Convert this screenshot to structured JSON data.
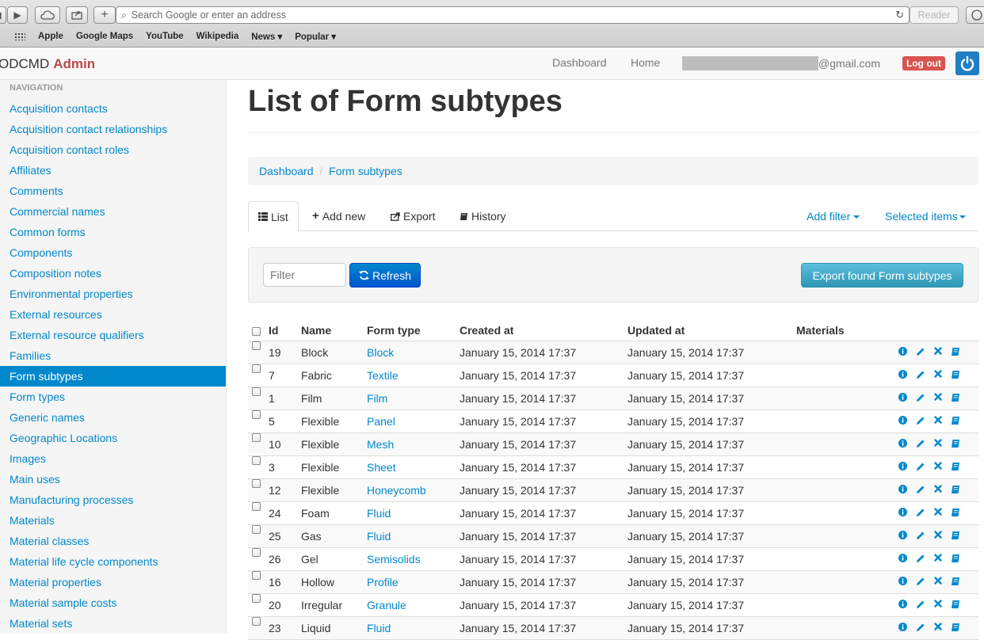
{
  "browser": {
    "address_placeholder": "Search Google or enter an address",
    "reader_label": "Reader",
    "bookmarks": [
      "Apple",
      "Google Maps",
      "YouTube",
      "Wikipedia",
      "News ▾",
      "Popular ▾"
    ]
  },
  "navbar": {
    "brand_prefix": "ODCMD",
    "brand_suffix": "Admin",
    "links": [
      "Dashboard",
      "Home"
    ],
    "email_suffix": "@gmail.com",
    "logout_label": "Log out"
  },
  "sidebar": {
    "header": "NAVIGATION",
    "items": [
      "Acquisition contacts",
      "Acquisition contact relationships",
      "Acquisition contact roles",
      "Affiliates",
      "Comments",
      "Commercial names",
      "Common forms",
      "Components",
      "Composition notes",
      "Environmental properties",
      "External resources",
      "External resource qualifiers",
      "Families",
      "Form subtypes",
      "Form types",
      "Generic names",
      "Geographic Locations",
      "Images",
      "Main uses",
      "Manufacturing processes",
      "Materials",
      "Material classes",
      "Material life cycle components",
      "Material properties",
      "Material sample costs",
      "Material sets"
    ],
    "active_index": 13
  },
  "main": {
    "title": "List of Form subtypes",
    "breadcrumb": [
      "Dashboard",
      "Form subtypes"
    ],
    "breadcrumb_sep": "/",
    "tabs": [
      "List",
      "Add new",
      "Export",
      "History"
    ],
    "tab_right": [
      "Add filter",
      "Selected items"
    ],
    "filter_placeholder": "Filter",
    "refresh_label": "Refresh",
    "export_label": "Export found Form subtypes"
  },
  "table": {
    "columns": [
      "Id",
      "Name",
      "Form type",
      "Created at",
      "Updated at",
      "Materials"
    ],
    "rows": [
      {
        "id": "19",
        "name": "Block",
        "form_type": "Block",
        "created": "January 15, 2014 17:37",
        "updated": "January 15, 2014 17:37"
      },
      {
        "id": "7",
        "name": "Fabric",
        "form_type": "Textile",
        "created": "January 15, 2014 17:37",
        "updated": "January 15, 2014 17:37"
      },
      {
        "id": "1",
        "name": "Film",
        "form_type": "Film",
        "created": "January 15, 2014 17:37",
        "updated": "January 15, 2014 17:37"
      },
      {
        "id": "5",
        "name": "Flexible",
        "form_type": "Panel",
        "created": "January 15, 2014 17:37",
        "updated": "January 15, 2014 17:37"
      },
      {
        "id": "10",
        "name": "Flexible",
        "form_type": "Mesh",
        "created": "January 15, 2014 17:37",
        "updated": "January 15, 2014 17:37"
      },
      {
        "id": "3",
        "name": "Flexible",
        "form_type": "Sheet",
        "created": "January 15, 2014 17:37",
        "updated": "January 15, 2014 17:37"
      },
      {
        "id": "12",
        "name": "Flexible",
        "form_type": "Honeycomb",
        "created": "January 15, 2014 17:37",
        "updated": "January 15, 2014 17:37"
      },
      {
        "id": "24",
        "name": "Foam",
        "form_type": "Fluid",
        "created": "January 15, 2014 17:37",
        "updated": "January 15, 2014 17:37"
      },
      {
        "id": "25",
        "name": "Gas",
        "form_type": "Fluid",
        "created": "January 15, 2014 17:37",
        "updated": "January 15, 2014 17:37"
      },
      {
        "id": "26",
        "name": "Gel",
        "form_type": "Semisolids",
        "created": "January 15, 2014 17:37",
        "updated": "January 15, 2014 17:37"
      },
      {
        "id": "16",
        "name": "Hollow",
        "form_type": "Profile",
        "created": "January 15, 2014 17:37",
        "updated": "January 15, 2014 17:37"
      },
      {
        "id": "20",
        "name": "Irregular",
        "form_type": "Granule",
        "created": "January 15, 2014 17:37",
        "updated": "January 15, 2014 17:37"
      },
      {
        "id": "23",
        "name": "Liquid",
        "form_type": "Fluid",
        "created": "January 15, 2014 17:37",
        "updated": "January 15, 2014 17:37"
      }
    ],
    "row_actions": [
      "info-icon",
      "pencil-icon",
      "delete-icon",
      "book-icon"
    ]
  },
  "colors": {
    "link": "#0088cc",
    "brand_accent": "#b94a48",
    "logout": "#d9534f",
    "export_button": "#5bc0de"
  }
}
